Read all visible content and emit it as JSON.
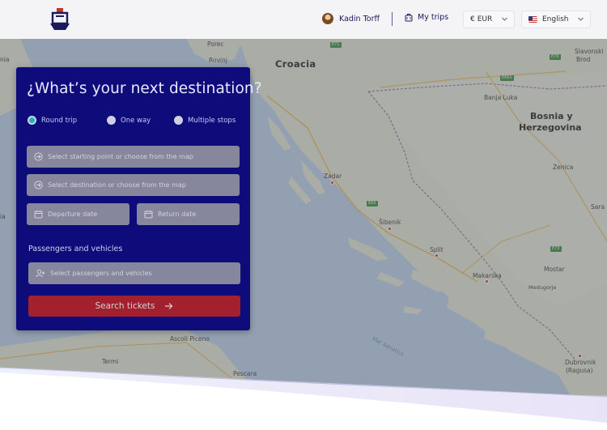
{
  "header": {
    "logo_icon": "ship-logo-icon",
    "user_name": "Kadin Torff",
    "my_trips": "My trips",
    "currency": {
      "symbol": "€",
      "code": "EUR"
    },
    "language": "English",
    "language_flag_icon": "us-flag-icon"
  },
  "map": {
    "regions": [
      "Croacia",
      "Bosnia y",
      "Herzegovina"
    ],
    "cities": [
      "Porec",
      "Rovinj",
      "Banja Luka",
      "Slavonski",
      "Brod",
      "Zenica",
      "Sara",
      "Zadar",
      "Šibenik",
      "Split",
      "Makarska",
      "Mostar",
      "Medugorje",
      "Dubrovnik",
      "(Ragusa)",
      "Ascoli Piceno",
      "Termi",
      "Pescara"
    ],
    "edge_labels": [
      "nia",
      "ia"
    ],
    "sea": "Mar Adriatico",
    "road_signs": [
      "E71",
      "E70",
      "E661",
      "E65",
      "E73"
    ]
  },
  "booking": {
    "title": "¿What’s your next destination?",
    "trip_types": [
      "Round trip",
      "One way",
      "Multiple stops"
    ],
    "selected_trip_type": "Round trip",
    "origin_placeholder": "Select starting point or choose from the map",
    "destination_placeholder": "Select destination or choose from the map",
    "departure_placeholder": "Departure date",
    "return_placeholder": "Return date",
    "passengers_label": "Passengers and vehicles",
    "passengers_placeholder": "Select passengers and vehicles",
    "search_button": "Search tickets"
  },
  "colors": {
    "card_bg": "#0e0b7a",
    "accent_red": "#a3202e",
    "radio_selected": "#1bb4b8",
    "header_text": "#1a1b5e"
  }
}
